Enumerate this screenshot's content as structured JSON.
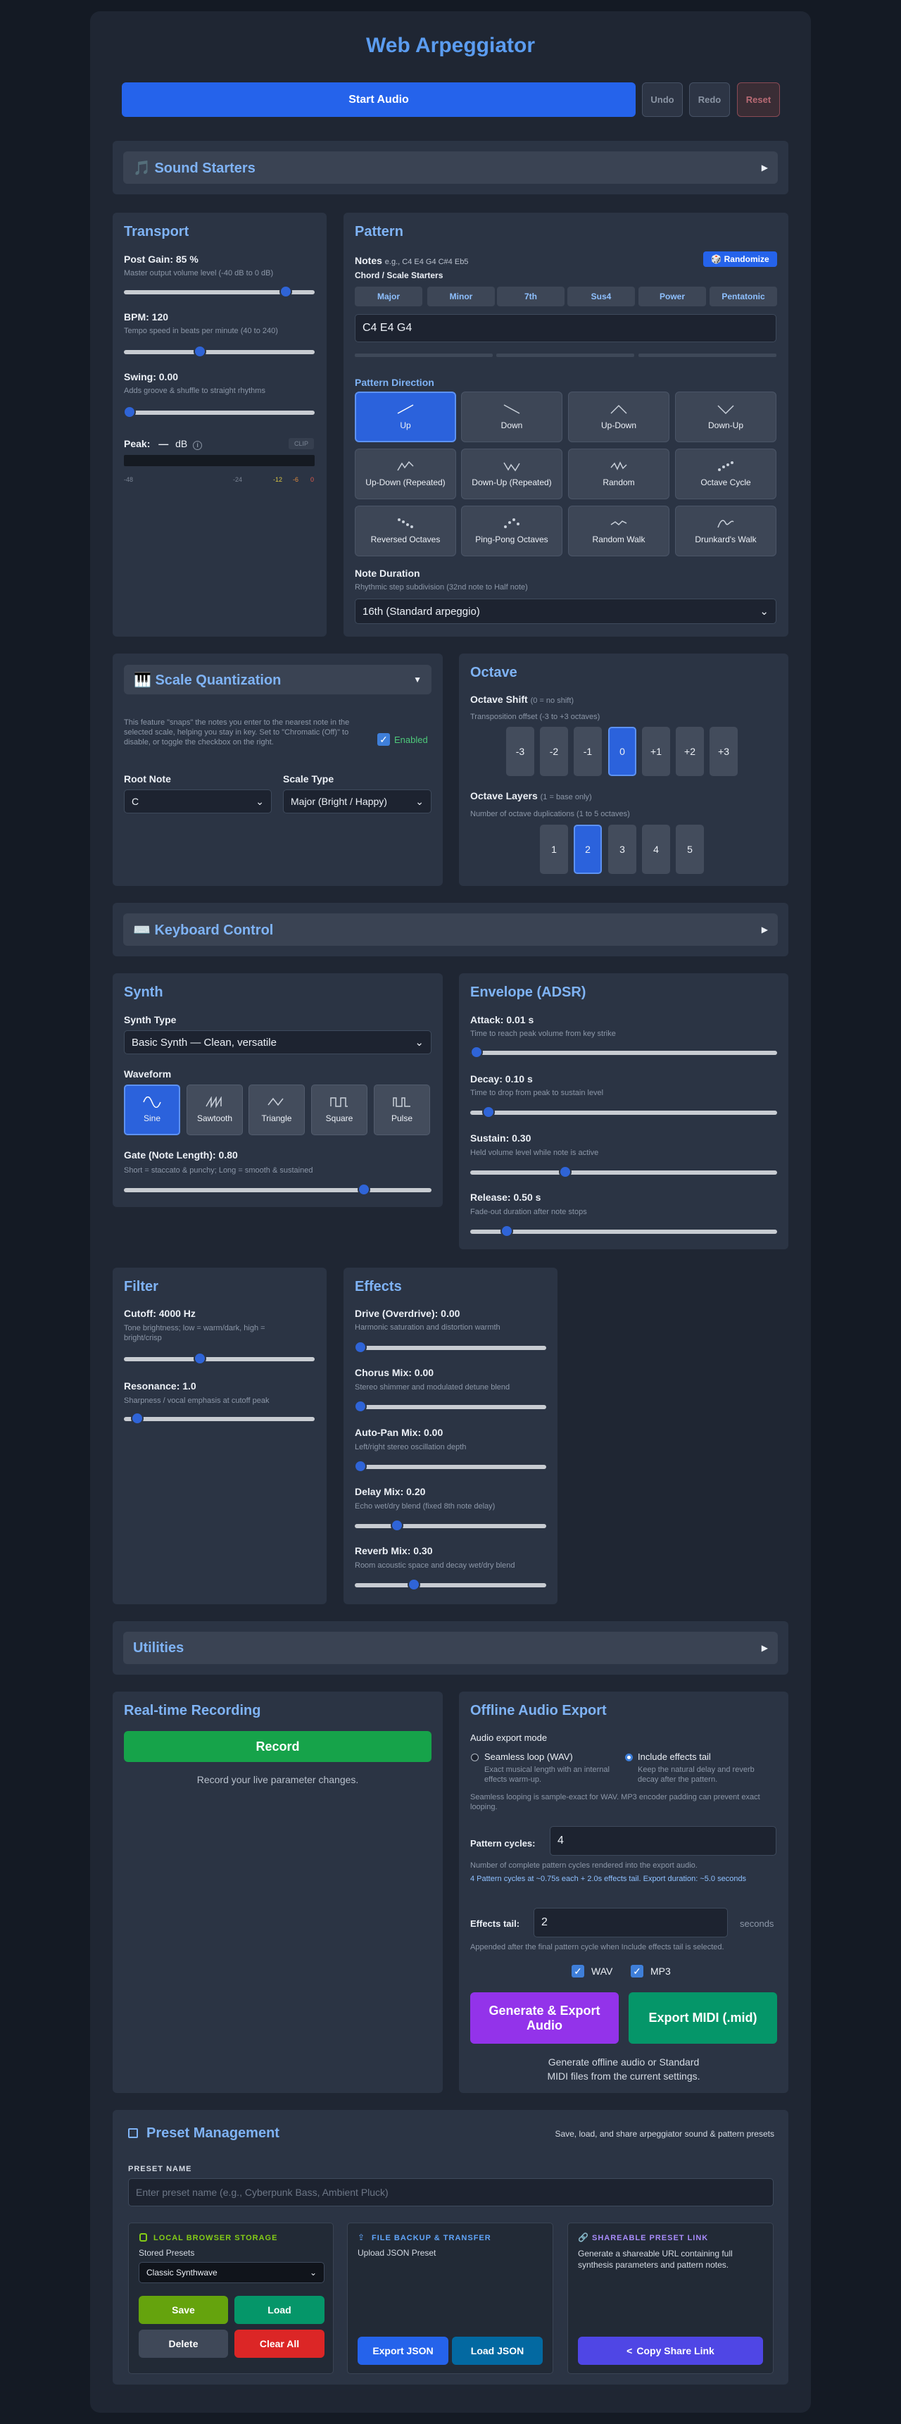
{
  "header": {
    "title": "Web Arpeggiator",
    "start": "Start Audio",
    "undo": "Undo",
    "redo": "Redo",
    "reset": "Reset"
  },
  "sound_starters": {
    "title": "🎵 Sound Starters"
  },
  "transport": {
    "title": "Transport",
    "post_gain": "Post Gain: 85 %",
    "post_gain_desc": "Master output volume level (-40 dB to 0 dB)",
    "post_gain_level": 0.85,
    "bpm": "BPM: 120",
    "bpm_desc": "Tempo speed in beats per minute (40 to 240)",
    "bpm_value": 120,
    "swing": "Swing: 0.00",
    "swing_desc": "Adds groove & shuffle to straight rhythms",
    "swing_level": 0,
    "peak": "Peak:",
    "peak_value": "—",
    "peak_unit": "dB",
    "clip": "CLIP",
    "meter_ticks": [
      "-48",
      "-24",
      "-12",
      "-6",
      "0"
    ]
  },
  "pattern": {
    "title": "Pattern",
    "notes_label": "Notes",
    "notes_example": "e.g., C4 E4 G4 C#4 Eb5",
    "randomize": "🎲 Randomize",
    "chord_label": "Chord / Scale Starters",
    "chords": [
      "Major",
      "Minor",
      "7th",
      "Sus4",
      "Power",
      "Pentatonic"
    ],
    "notes_value": "C4 E4 G4",
    "direction_label": "Pattern Direction",
    "directions": [
      "Up",
      "Down",
      "Up-Down",
      "Down-Up",
      "Up-Down (Repeated)",
      "Down-Up (Repeated)",
      "Random",
      "Octave Cycle",
      "Reversed Octaves",
      "Ping-Pong Octaves",
      "Random Walk",
      "Drunkard's Walk"
    ],
    "duration_label": "Note Duration",
    "duration_desc": "Rhythmic step subdivision (32nd note to Half note)",
    "duration_value": "16th (Standard arpeggio)"
  },
  "scale": {
    "title": "🎹 Scale Quantization",
    "desc": "This feature \"snaps\" the notes you enter to the nearest note in the selected scale, helping you stay in key. Set to \"Chromatic (Off)\" to disable, or toggle the checkbox on the right.",
    "enabled": "Enabled",
    "root_label": "Root Note",
    "root_value": "C",
    "type_label": "Scale Type",
    "type_value": "Major (Bright / Happy)"
  },
  "octave": {
    "title": "Octave",
    "shift_label": "Octave Shift",
    "shift_hint": "(0 = no shift)",
    "shift_desc": "Transposition offset (-3 to +3 octaves)",
    "shifts": [
      "-3",
      "-2",
      "-1",
      "0",
      "+1",
      "+2",
      "+3"
    ],
    "layers_label": "Octave Layers",
    "layers_hint": "(1 = base only)",
    "layers_desc": "Number of octave duplications (1 to 5 octaves)",
    "layers": [
      "1",
      "2",
      "3",
      "4",
      "5"
    ]
  },
  "keyboard": {
    "title": "⌨️ Keyboard Control"
  },
  "synth": {
    "title": "Synth",
    "type_label": "Synth Type",
    "type_value": "Basic Synth — Clean, versatile",
    "waveform_label": "Waveform",
    "waveforms": [
      "Sine",
      "Sawtooth",
      "Triangle",
      "Square",
      "Pulse"
    ],
    "gate": "Gate (Note Length): 0.80",
    "gate_desc": "Short = staccato & punchy; Long = smooth & sustained",
    "gate_value": 0.8
  },
  "envelope": {
    "title": "Envelope (ADSR)",
    "attack": "Attack: 0.01 s",
    "attack_desc": "Time to reach peak volume from key strike",
    "attack_value": 0.01,
    "decay": "Decay: 0.10 s",
    "decay_desc": "Time to drop from peak to sustain level",
    "decay_value": 0.1,
    "sustain": "Sustain: 0.30",
    "sustain_desc": "Held volume level while note is active",
    "sustain_value": 0.3,
    "release": "Release: 0.50 s",
    "release_desc": "Fade-out duration after note stops",
    "release_value": 0.5
  },
  "filter": {
    "title": "Filter",
    "cutoff": "Cutoff: 4000 Hz",
    "cutoff_desc": "Tone brightness; low = warm/dark, high = bright/crisp",
    "cutoff_value": 4000,
    "res": "Resonance: 1.0",
    "res_desc": "Sharpness / vocal emphasis at cutoff peak",
    "res_value": 1.0
  },
  "effects": {
    "title": "Effects",
    "drive": "Drive (Overdrive): 0.00",
    "drive_desc": "Harmonic saturation and distortion warmth",
    "drive_value": 0,
    "chorus": "Chorus Mix: 0.00",
    "chorus_desc": "Stereo shimmer and modulated detune blend",
    "chorus_value": 0,
    "autopan": "Auto-Pan Mix: 0.00",
    "autopan_desc": "Left/right stereo oscillation depth",
    "autopan_value": 0,
    "delay": "Delay Mix: 0.20",
    "delay_desc": "Echo wet/dry blend (fixed 8th note delay)",
    "delay_value": 0.2,
    "reverb": "Reverb Mix: 0.30",
    "reverb_desc": "Room acoustic space and decay wet/dry blend",
    "reverb_value": 0.3
  },
  "utilities": {
    "title": "Utilities"
  },
  "recording": {
    "title": "Real-time Recording",
    "record": "Record",
    "desc": "Record your live parameter changes."
  },
  "export": {
    "title": "Offline Audio Export",
    "mode_label": "Audio export mode",
    "opt1": "Seamless loop (WAV)",
    "opt1_desc": "Exact musical length with an internal effects warm-up.",
    "opt2": "Include effects tail",
    "opt2_desc": "Keep the natural delay and reverb decay after the pattern.",
    "note": "Seamless looping is sample-exact for WAV. MP3 encoder padding can prevent exact looping.",
    "cycles_label": "Pattern cycles:",
    "cycles_value": "4",
    "cycles_desc": "Number of complete pattern cycles rendered into the export audio.",
    "calc": "4 Pattern cycles at ~0.75s each + 2.0s effects tail. Export duration: ~5.0 seconds",
    "tail_label": "Effects tail:",
    "tail_value": "2",
    "tail_unit": "seconds",
    "tail_desc": "Appended after the final pattern cycle when Include effects tail is selected.",
    "wav": "WAV",
    "mp3": "MP3",
    "gen": "Generate & Export Audio",
    "midi": "Export MIDI (.mid)",
    "footer": "Generate offline audio or Standard MIDI files from the current settings."
  },
  "presets": {
    "title": "Preset Management",
    "tagline": "Save, load, and share arpeggiator sound & pattern presets",
    "name_label": "PRESET NAME",
    "name_placeholder": "Enter preset name (e.g., Cyberpunk Bass, Ambient Pluck)",
    "local_title": "LOCAL BROWSER STORAGE",
    "stored_label": "Stored Presets",
    "stored_value": "Classic Synthwave",
    "save": "Save",
    "load": "Load",
    "delete": "Delete",
    "clear": "Clear All",
    "backup_title": "FILE BACKUP & TRANSFER",
    "backup_desc": "Upload JSON Preset",
    "export_json": "Export JSON",
    "load_json": "Load JSON",
    "share_title": "SHAREABLE PRESET LINK",
    "share_desc": "Generate a shareable URL containing full synthesis parameters and pattern notes.",
    "copy": "Copy Share Link"
  },
  "colors": {
    "accent": "#2563eb",
    "heading": "#7fb3f5",
    "record": "#16a34a",
    "export": "#9333ea",
    "midi": "#059669",
    "danger": "#dc2626",
    "copy": "#4f46e5"
  }
}
